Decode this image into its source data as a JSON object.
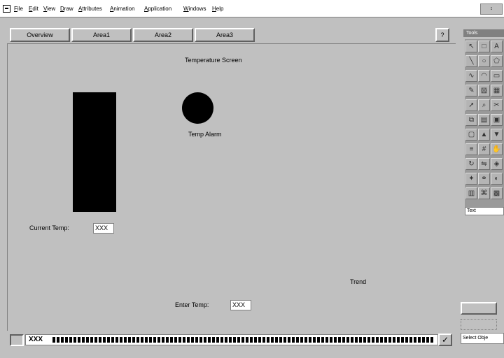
{
  "menubar": {
    "items": [
      "File",
      "Edit",
      "View",
      "Draw",
      "Attributes",
      "Animation",
      "Application",
      "Windows",
      "Help"
    ],
    "restore_label": "↕"
  },
  "toolbar": {
    "tabs": [
      "Overview",
      "Area1",
      "Area2",
      "Area3"
    ],
    "help_label": "?"
  },
  "screen": {
    "title": "Temperature Screen",
    "temp_alarm_label": "Temp Alarm",
    "current_temp_label": "Current Temp:",
    "current_temp_value": "XXX",
    "trend_label": "Trend",
    "enter_temp_label": "Enter Temp:",
    "enter_temp_value": "XXX"
  },
  "tools": {
    "title": "Tools",
    "caption": "Text",
    "icons": [
      "select-icon",
      "rectangle-icon",
      "text-tool-icon",
      "line-icon",
      "ellipse-icon",
      "polygon-icon",
      "polyline-icon",
      "arc-icon",
      "button-icon",
      "pen-icon",
      "fill-icon",
      "bitmap-icon",
      "arrow-icon",
      "zoom-icon",
      "cut-icon",
      "copy-icon",
      "paste-icon",
      "group-icon",
      "ungroup-icon",
      "front-icon",
      "back-icon",
      "align-icon",
      "grid-icon",
      "hand-icon",
      "rotate-icon",
      "flip-icon",
      "symbol-icon",
      "wizard-icon",
      "link-icon",
      "palette-icon",
      "layer-icon",
      "tag-icon",
      "lock-icon"
    ]
  },
  "commandline": {
    "text": "XXX",
    "ok_label": "✓"
  },
  "status": {
    "text": "Select Obje"
  },
  "colors": {
    "background": "#c0c0c0",
    "indicator": "#000000"
  }
}
